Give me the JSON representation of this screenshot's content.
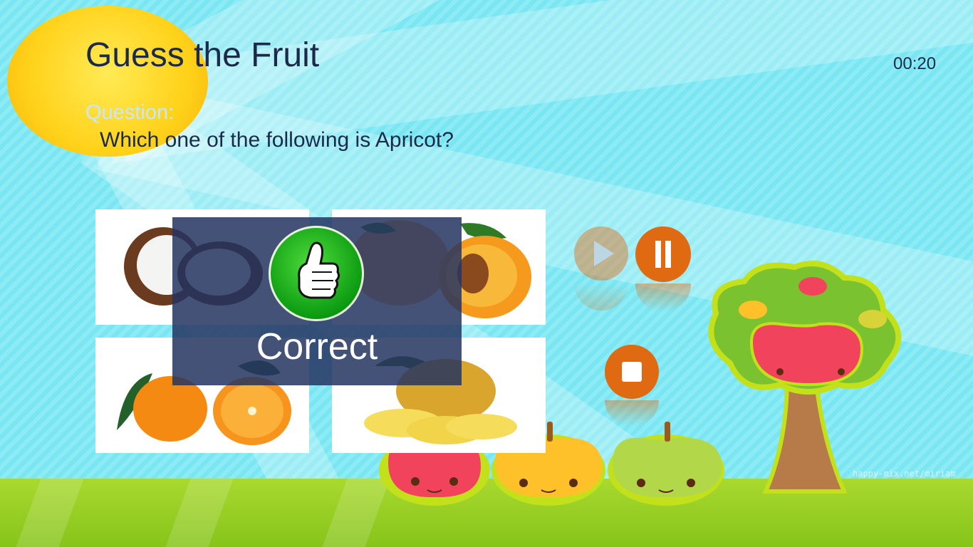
{
  "app": {
    "title": "Guess the Fruit",
    "timer": "00:20"
  },
  "question": {
    "label": "Question:",
    "text": "Which one of the following is Apricot?"
  },
  "options": [
    {
      "fruit": "coconut"
    },
    {
      "fruit": "apricot"
    },
    {
      "fruit": "tangerine"
    },
    {
      "fruit": "pineapple"
    }
  ],
  "feedback": {
    "text": "Correct",
    "icon": "thumbs-up-icon"
  },
  "controls": {
    "play": "play-icon",
    "pause": "pause-icon",
    "stop": "stop-icon"
  },
  "watermark": "happy-mix.net/miriam",
  "colors": {
    "accent": "#e06a12",
    "overlay": "#243460",
    "success": "#17b817"
  }
}
